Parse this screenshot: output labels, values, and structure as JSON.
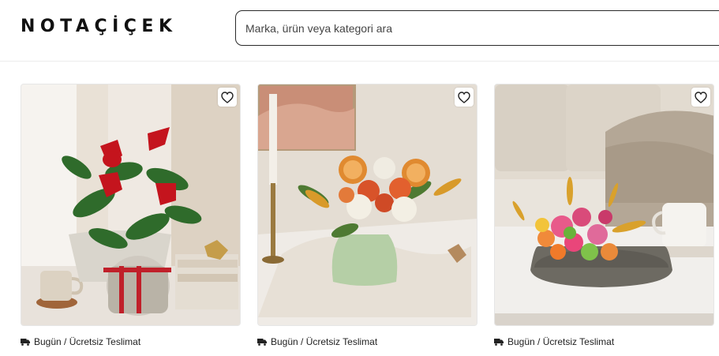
{
  "header": {
    "logo_text": "NOTAÇİÇEK",
    "search_placeholder": "Marka, ürün veya kategori ara"
  },
  "products": [
    {
      "delivery": "Bugün / Ücretsiz Teslimat",
      "fav_icon": "heart-icon"
    },
    {
      "delivery": "Bugün / Ücretsiz Teslimat",
      "fav_icon": "heart-icon"
    },
    {
      "delivery": "Bugün / Ücretsiz Teslimat",
      "fav_icon": "heart-icon"
    }
  ],
  "colors": {
    "text": "#1a1a1a",
    "border": "#2a2a2a"
  }
}
